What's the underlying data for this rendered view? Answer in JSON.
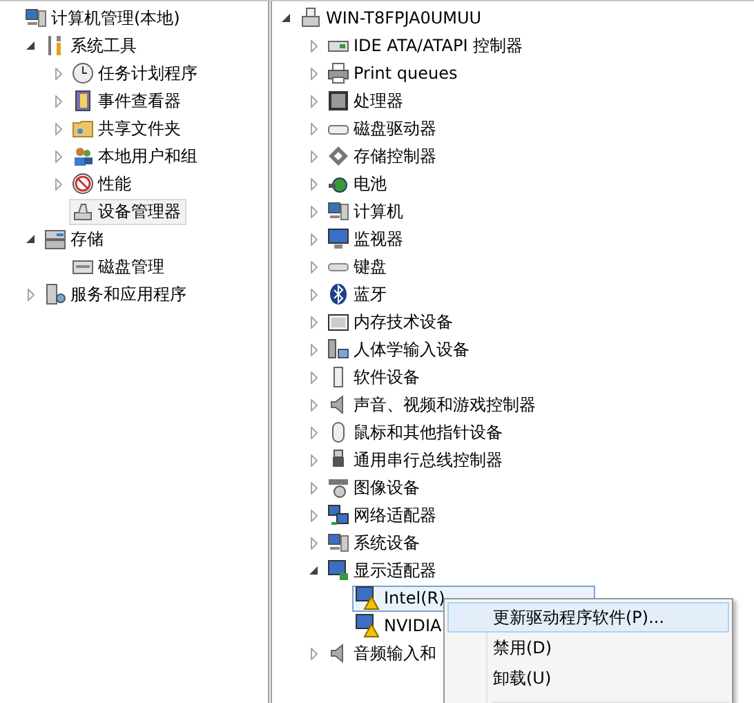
{
  "left_tree": {
    "label": "计算机管理(本地)",
    "selected": false,
    "children": [
      {
        "label": "系统工具",
        "expanded": true,
        "selected": false,
        "children": [
          {
            "label": "任务计划程序",
            "expanded": false,
            "selected": false
          },
          {
            "label": "事件查看器",
            "expanded": false,
            "selected": false
          },
          {
            "label": "共享文件夹",
            "expanded": false,
            "selected": false
          },
          {
            "label": "本地用户和组",
            "expanded": false,
            "selected": false
          },
          {
            "label": "性能",
            "expanded": false,
            "selected": false
          },
          {
            "label": "设备管理器",
            "selected": true
          }
        ]
      },
      {
        "label": "存储",
        "expanded": true,
        "selected": false,
        "children": [
          {
            "label": "磁盘管理",
            "selected": false
          }
        ]
      },
      {
        "label": "服务和应用程序",
        "expanded": false,
        "selected": false
      }
    ]
  },
  "device_tree": {
    "label": "WIN-T8FPJA0UMUU",
    "expanded": true,
    "selected": false,
    "children": [
      {
        "label": "IDE ATA/ATAPI 控制器",
        "expanded": false,
        "selected": false
      },
      {
        "label": "Print queues",
        "expanded": false,
        "selected": false
      },
      {
        "label": "处理器",
        "expanded": false,
        "selected": false
      },
      {
        "label": "磁盘驱动器",
        "expanded": false,
        "selected": false
      },
      {
        "label": "存储控制器",
        "expanded": false,
        "selected": false
      },
      {
        "label": "电池",
        "expanded": false,
        "selected": false
      },
      {
        "label": "计算机",
        "expanded": false,
        "selected": false
      },
      {
        "label": "监视器",
        "expanded": false,
        "selected": false
      },
      {
        "label": "键盘",
        "expanded": false,
        "selected": false
      },
      {
        "label": "蓝牙",
        "expanded": false,
        "selected": false
      },
      {
        "label": "内存技术设备",
        "expanded": false,
        "selected": false
      },
      {
        "label": "人体学输入设备",
        "expanded": false,
        "selected": false
      },
      {
        "label": "软件设备",
        "expanded": false,
        "selected": false
      },
      {
        "label": "声音、视频和游戏控制器",
        "expanded": false,
        "selected": false
      },
      {
        "label": "鼠标和其他指针设备",
        "expanded": false,
        "selected": false
      },
      {
        "label": "通用串行总线控制器",
        "expanded": false,
        "selected": false
      },
      {
        "label": "图像设备",
        "expanded": false,
        "selected": false
      },
      {
        "label": "网络适配器",
        "expanded": false,
        "selected": false
      },
      {
        "label": "系统设备",
        "expanded": false,
        "selected": false
      },
      {
        "label": "显示适配器",
        "expanded": true,
        "selected": false,
        "children": [
          {
            "label": "Intel(R)",
            "selected": true,
            "warning": true
          },
          {
            "label": "NVIDIA",
            "selected": false,
            "warning": true
          }
        ]
      },
      {
        "label": "音频输入和",
        "expanded": false,
        "selected": false
      }
    ]
  },
  "context_menu": {
    "items": [
      {
        "label": "更新驱动程序软件(P)...",
        "selected": true
      },
      {
        "label": "禁用(D)",
        "selected": false
      },
      {
        "label": "卸载(U)",
        "selected": false
      }
    ]
  }
}
